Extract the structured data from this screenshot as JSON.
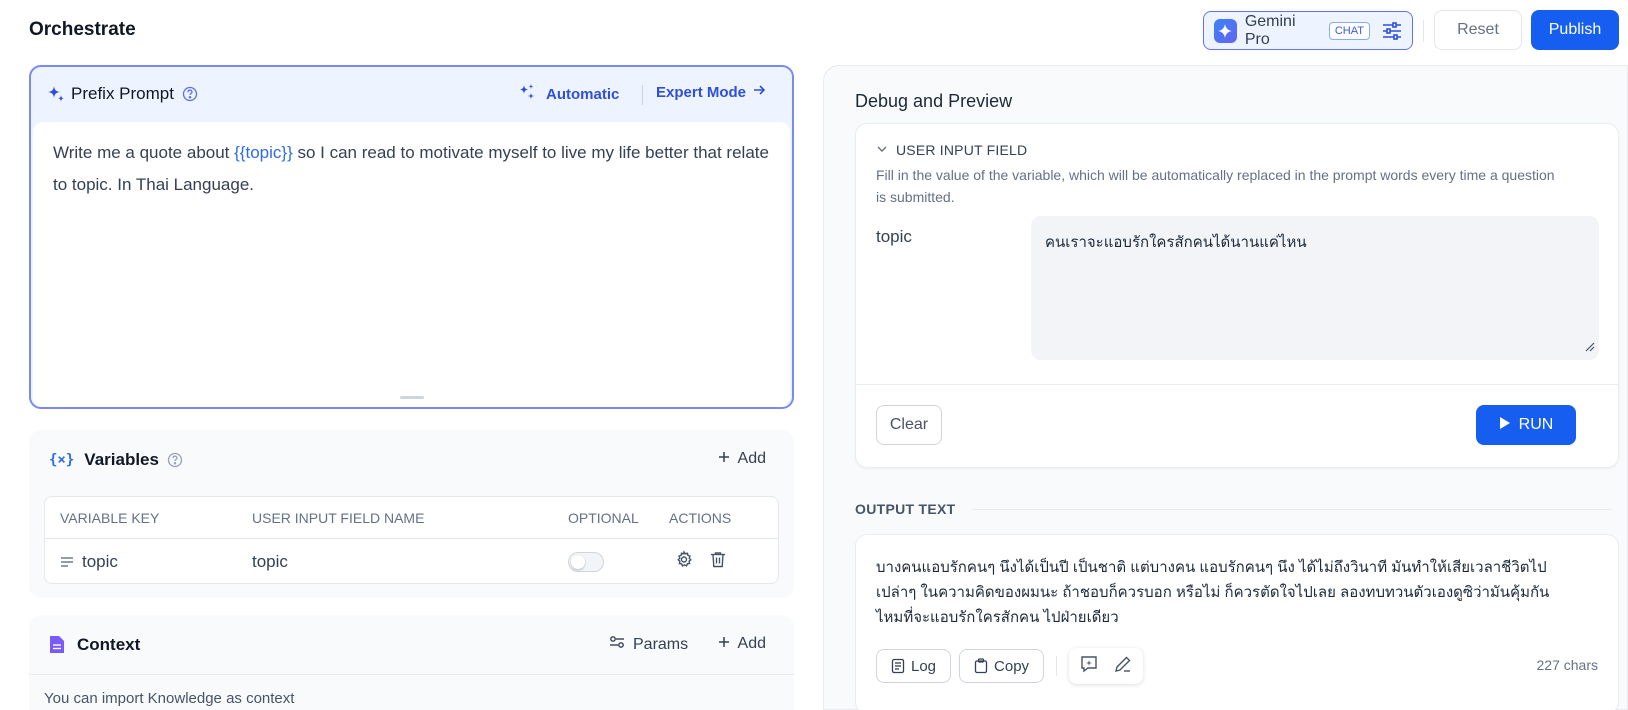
{
  "header": {
    "title": "Orchestrate",
    "model_name": "Gemini Pro",
    "model_badge": "CHAT",
    "reset_label": "Reset",
    "publish_label": "Publish"
  },
  "prompt": {
    "title": "Prefix Prompt",
    "automatic_label": "Automatic",
    "expert_label": "Expert Mode",
    "text_before": "Write me a quote about ",
    "variable": "{{topic}}",
    "text_after": " so I can read  to motivate myself to live my life better that relate to topic. In Thai Language."
  },
  "variables": {
    "title": "Variables",
    "add_label": "Add",
    "columns": [
      "VARIABLE KEY",
      "USER INPUT FIELD NAME",
      "OPTIONAL",
      "ACTIONS"
    ],
    "rows": [
      {
        "key": "topic",
        "name": "topic",
        "optional": false
      }
    ]
  },
  "context": {
    "title": "Context",
    "params_label": "Params",
    "add_label": "Add",
    "hint": "You can import Knowledge as context"
  },
  "debug": {
    "title": "Debug and Preview",
    "section_label": "USER INPUT FIELD",
    "description": "Fill in the value of the variable, which will be automatically replaced in the prompt words every time a question is submitted.",
    "field_label": "topic",
    "field_value": "คนเราจะแอบรักใครสักคนได้นานแค่ไหน",
    "clear_label": "Clear",
    "run_label": "RUN"
  },
  "output": {
    "label": "OUTPUT TEXT",
    "text": "บางคนแอบรักคนๆ นึงได้เป็นปี เป็นชาติ แต่บางคน แอบรักคนๆ นึง ได้ไม่ถึงวินาที มันทำให้เสียเวลาชีวิตไปเปล่าๆ ในความคิดของผมนะ ถ้าชอบก็ควรบอก หรือไม่ ก็ควรตัดใจไปเลย ลองทบทวนตัวเองดูซิว่ามันคุ้มกันไหมที่จะแอบรักใครสักคน ไปฝ่ายเดียว",
    "log_label": "Log",
    "copy_label": "Copy",
    "char_count": "227 chars"
  },
  "colors": {
    "primary": "#155eef",
    "accent": "#2f4fd8",
    "prompt_border": "#7a8af5"
  }
}
